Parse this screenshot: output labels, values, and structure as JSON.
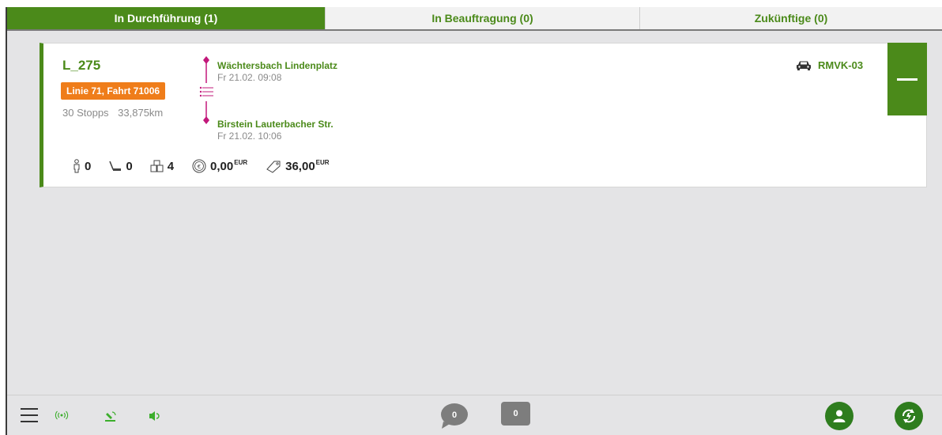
{
  "tabs": [
    {
      "label": "In Durchführung (1)",
      "active": true
    },
    {
      "label": "In Beauftragung (0)",
      "active": false
    },
    {
      "label": "Zukünftige (0)",
      "active": false
    }
  ],
  "tour": {
    "id": "L_275",
    "line_badge": "Linie 71, Fahrt 71006",
    "stops": "30 Stopps",
    "distance": "33,875km",
    "start_stop": {
      "name": "Wächtersbach Lindenplatz",
      "time": "Fr 21.02. 09:08"
    },
    "end_stop": {
      "name": "Birstein Lauterbacher Str.",
      "time": "Fr 21.02. 10:06"
    },
    "vehicle": "RMVK-03",
    "metrics": {
      "passengers": "0",
      "wheelchair": "0",
      "luggage": "4",
      "cash": "0,00",
      "cash_currency": "EUR",
      "ticket": "36,00",
      "ticket_currency": "EUR"
    }
  },
  "bottom": {
    "chat_count": "0",
    "message_count": "0"
  },
  "colors": {
    "brand_green": "#4b8a1a",
    "badge_orange": "#ef7d1a",
    "route_magenta": "#c2187a",
    "round_button_green": "#2e7d1e"
  },
  "icons": {
    "passenger": "person-icon",
    "wheelchair": "wheelchair-icon",
    "luggage": "luggage-icon",
    "cash": "coin-icon",
    "ticket": "ticket-icon",
    "vehicle": "car-icon",
    "menu": "hamburger-icon",
    "gps": "signal-icon",
    "satellite": "satellite-icon",
    "sound": "speaker-icon",
    "chat": "chat-bubble-icon",
    "user": "user-icon",
    "sync": "sync-icon"
  }
}
